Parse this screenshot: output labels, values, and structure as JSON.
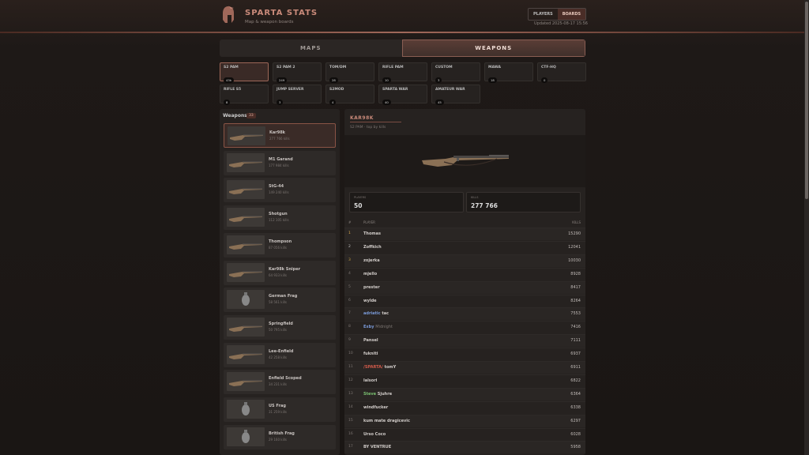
{
  "header": {
    "brand": "SPARTA STATS",
    "subtitle": "Map & weapon boards",
    "nav": [
      "PLAYERS",
      "BOARDS"
    ],
    "updated": "Updated 2025-08-17 15:56"
  },
  "tabs": [
    "MAPS",
    "WEAPONS"
  ],
  "servers": [
    {
      "name": "S2 PAM",
      "count": "43k"
    },
    {
      "name": "S2 PAM 2",
      "count": "249"
    },
    {
      "name": "TOM/DM",
      "count": "28"
    },
    {
      "name": "RIFLE PAM",
      "count": "10"
    },
    {
      "name": "CUSTOM",
      "count": "3"
    },
    {
      "name": "MAWA",
      "count": "18"
    },
    {
      "name": "CTF-HQ",
      "count": "0"
    },
    {
      "name": "RIFLE S5",
      "count": "8"
    },
    {
      "name": "JUMP SERVER",
      "count": "3"
    },
    {
      "name": "S2MOD",
      "count": "4"
    },
    {
      "name": "SPARTA WAR",
      "count": "40"
    },
    {
      "name": "AMATEUR WAR",
      "count": "45"
    }
  ],
  "weapons_panel": {
    "title": "Weapons",
    "count": "33",
    "items": [
      {
        "name": "Kar98k",
        "kills": "277 766 kills"
      },
      {
        "name": "M1 Garand",
        "kills": "177 984 kills"
      },
      {
        "name": "StG-44",
        "kills": "149 240 kills"
      },
      {
        "name": "Shotgun",
        "kills": "112 105 kills"
      },
      {
        "name": "Thompson",
        "kills": "87 056 kills"
      },
      {
        "name": "Kar98k Sniper",
        "kills": "64 933 kills"
      },
      {
        "name": "German Frag",
        "kills": "58 561 kills"
      },
      {
        "name": "Springfield",
        "kills": "50 795 kills"
      },
      {
        "name": "Lee-Enfield",
        "kills": "42 258 kills"
      },
      {
        "name": "Enfield Scoped",
        "kills": "34 231 kills"
      },
      {
        "name": "US Frag",
        "kills": "31 259 kills"
      },
      {
        "name": "British Frag",
        "kills": "29 160 kills"
      }
    ]
  },
  "detail": {
    "title": "KAR98K",
    "subtitle": "S2 PAM · top by kills",
    "stats": [
      {
        "label": "PLAYERS",
        "value": "50"
      },
      {
        "label": "KILLS",
        "value": "277 766"
      }
    ],
    "columns": {
      "rank": "#",
      "player": "PLAYER",
      "kills": "KILLS"
    },
    "rows": [
      {
        "rank": "1",
        "prefix": "",
        "name": "Thomas",
        "kills": "15290"
      },
      {
        "rank": "2",
        "prefix": "",
        "name": "Zoffkich",
        "kills": "12041"
      },
      {
        "rank": "3",
        "prefix": "",
        "name": "zojerka",
        "kills": "10030"
      },
      {
        "rank": "4",
        "prefix": "",
        "name": "mjello",
        "kills": "8928"
      },
      {
        "rank": "5",
        "prefix": "",
        "name": "prester",
        "kills": "8417"
      },
      {
        "rank": "6",
        "prefix": "",
        "name": "wylde",
        "kills": "8264"
      },
      {
        "rank": "7",
        "prefix": "adriatic",
        "name": "tac",
        "kills": "7553"
      },
      {
        "rank": "8",
        "prefix": "Exby",
        "name": "Midnight",
        "kills": "7416"
      },
      {
        "rank": "9",
        "prefix": "",
        "name": "Pansel",
        "kills": "7111"
      },
      {
        "rank": "10",
        "prefix": "",
        "name": "fukniti",
        "kills": "6937"
      },
      {
        "rank": "11",
        "prefix": "/SPARTA/",
        "name": "tomY",
        "kills": "6911"
      },
      {
        "rank": "12",
        "prefix": "",
        "name": "lalsori",
        "kills": "6822"
      },
      {
        "rank": "13",
        "prefix": "Steve",
        "name": "Sjuhre",
        "kills": "6364"
      },
      {
        "rank": "14",
        "prefix": "",
        "name": "windfucker",
        "kills": "6338"
      },
      {
        "rank": "15",
        "prefix": "",
        "name": "kum mate dragicevic",
        "kills": "6297"
      },
      {
        "rank": "16",
        "prefix": "",
        "name": "Urso Coco",
        "kills": "6028"
      },
      {
        "rank": "17",
        "prefix": "",
        "name": "BY VENTRUE",
        "kills": "5958"
      }
    ]
  },
  "colors": {
    "accent": "#c98a7a",
    "accent_dark": "#4a2d27",
    "panel": "#262220",
    "background": "#1d1816"
  }
}
